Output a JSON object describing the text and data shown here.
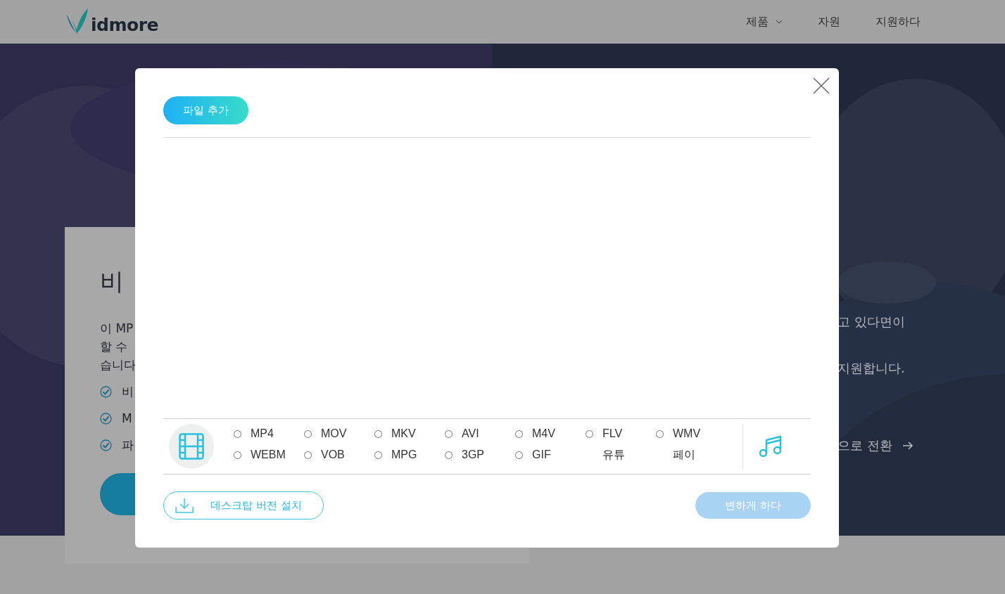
{
  "header": {
    "logo": "idmore",
    "nav": [
      {
        "label": "제품",
        "dropdown": true
      },
      {
        "label": "자원",
        "dropdown": false
      },
      {
        "label": "지원하다",
        "dropdown": false
      }
    ]
  },
  "hero": {
    "card": {
      "title": "비",
      "lines": [
        "이 MP",
        "할 수",
        "습니다"
      ],
      "checks": [
        "비",
        "M",
        "파"
      ]
    },
    "right": {
      "lines": [
        "고 있다면이",
        "지원합니다."
      ],
      "link": "으로 전환"
    }
  },
  "dialog": {
    "add_button": "파일 추가",
    "formats": [
      {
        "label": "MP4",
        "selected": false
      },
      {
        "label": "MOV",
        "selected": false
      },
      {
        "label": "MKV",
        "selected": false
      },
      {
        "label": "AVI",
        "selected": false
      },
      {
        "label": "M4V",
        "selected": false
      },
      {
        "label": "FLV",
        "selected": false
      },
      {
        "label": "WMV",
        "selected": false
      },
      {
        "label": "WEBM",
        "selected": false
      },
      {
        "label": "VOB",
        "selected": false
      },
      {
        "label": "MPG",
        "selected": false
      },
      {
        "label": "3GP",
        "selected": false
      },
      {
        "label": "GIF",
        "selected": false
      },
      {
        "label": "유튜",
        "kind": "text"
      },
      {
        "label": "페이",
        "kind": "text"
      }
    ],
    "install_button": "데스크탑 버전 설치",
    "convert_button": {
      "label": "변하게 하다",
      "disabled": true
    }
  }
}
